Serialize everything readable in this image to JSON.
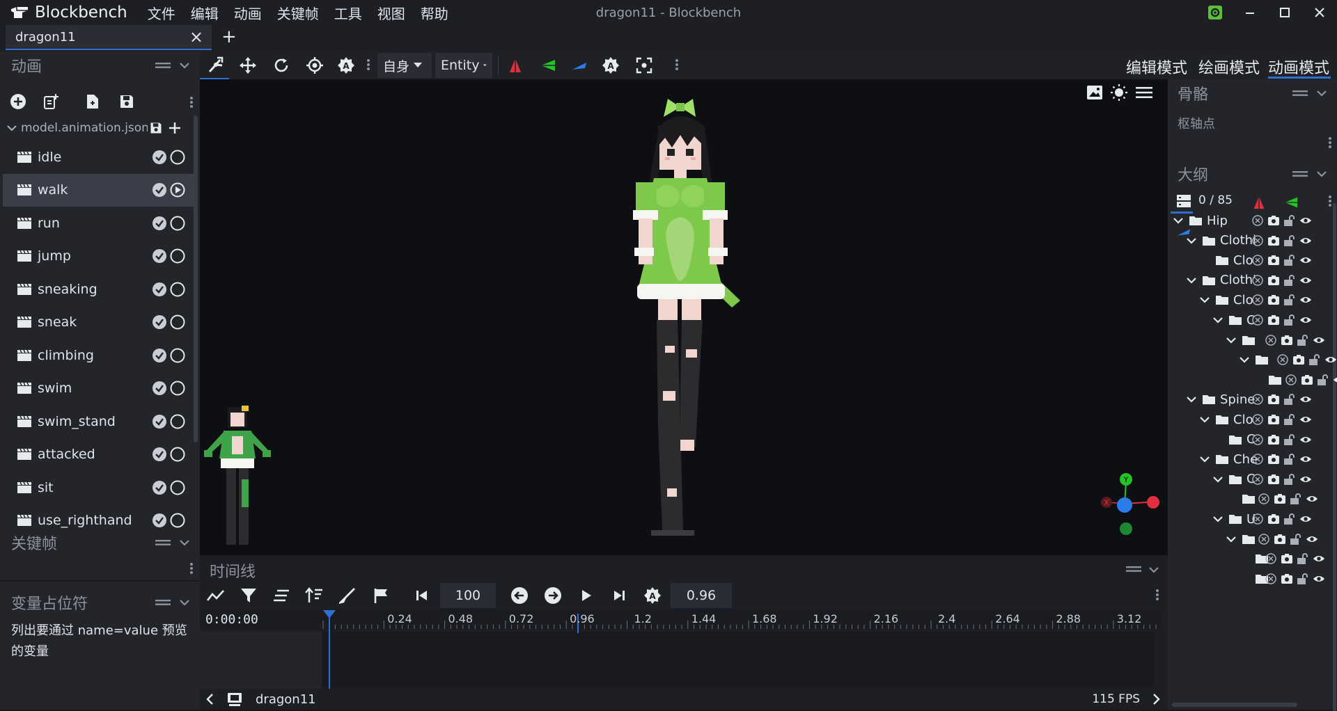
{
  "app": {
    "name": "Blockbench",
    "window_title": "dragon11 - Blockbench"
  },
  "menu": [
    "文件",
    "编辑",
    "动画",
    "关键帧",
    "工具",
    "视图",
    "帮助"
  ],
  "tab": {
    "label": "dragon11",
    "close": "×",
    "new": "+"
  },
  "colors": {
    "accent": "#2f6fd2",
    "x_axis": "#e0303f",
    "y_axis": "#27c227",
    "z_axis": "#2b7de8",
    "selected_row": "#3a3e49"
  },
  "animations_panel": {
    "title": "动画",
    "file": "model.animation.json",
    "items": [
      {
        "label": "idle",
        "playing": false
      },
      {
        "label": "walk",
        "playing": true
      },
      {
        "label": "run",
        "playing": false
      },
      {
        "label": "jump",
        "playing": false
      },
      {
        "label": "sneaking",
        "playing": false
      },
      {
        "label": "sneak",
        "playing": false
      },
      {
        "label": "climbing",
        "playing": false
      },
      {
        "label": "swim",
        "playing": false
      },
      {
        "label": "swim_stand",
        "playing": false
      },
      {
        "label": "attacked",
        "playing": false
      },
      {
        "label": "sit",
        "playing": false
      },
      {
        "label": "use_righthand",
        "playing": false
      }
    ],
    "selected_index": 1
  },
  "keyframe_panel": {
    "title": "关键帧"
  },
  "variables_panel": {
    "title": "变量占位符",
    "text": "列出要通过 name=value 预览的变量"
  },
  "toolbar": {
    "space_select": "自身",
    "pivot_select": "Entity"
  },
  "modes": {
    "edit": "编辑模式",
    "paint": "绘画模式",
    "animate": "动画模式",
    "active": "animate"
  },
  "bone_panel": {
    "title": "骨骼",
    "subtitle": "枢轴点"
  },
  "outliner": {
    "title": "大纲",
    "count": "0 / 85",
    "rows": [
      {
        "label": "Hip",
        "expanded": true
      },
      {
        "label": "Clothi",
        "expanded": true
      },
      {
        "label": "Clo",
        "expanded": false
      },
      {
        "label": "Cloth'",
        "expanded": true
      },
      {
        "label": "Clo",
        "expanded": true
      },
      {
        "label": "C",
        "expanded": true
      },
      {
        "label": "",
        "expanded": true
      },
      {
        "label": "",
        "expanded": true
      },
      {
        "label": "",
        "expanded": false
      },
      {
        "label": "Spine",
        "expanded": true
      },
      {
        "label": "Clo",
        "expanded": true
      },
      {
        "label": "C",
        "expanded": false
      },
      {
        "label": "Che",
        "expanded": true
      },
      {
        "label": "C",
        "expanded": true
      },
      {
        "label": "",
        "expanded": false
      },
      {
        "label": "U",
        "expanded": true
      },
      {
        "label": "",
        "expanded": true
      },
      {
        "label": "",
        "expanded": false
      },
      {
        "label": "",
        "expanded": false
      }
    ]
  },
  "timeline": {
    "title": "时间线",
    "time_display": "0:00:00",
    "animation_length": "100",
    "playback_speed": "0.96",
    "ticks": [
      "0.24",
      "0.48",
      "0.72",
      "0.96",
      "1.2",
      "1.44",
      "1.68",
      "1.92",
      "2.16",
      "2.4",
      "2.64",
      "2.88",
      "3.12"
    ]
  },
  "statusbar": {
    "project": "dragon11",
    "fps": "115 FPS"
  },
  "viewport": {
    "gizmo_labels": [
      "Y",
      "X"
    ]
  }
}
